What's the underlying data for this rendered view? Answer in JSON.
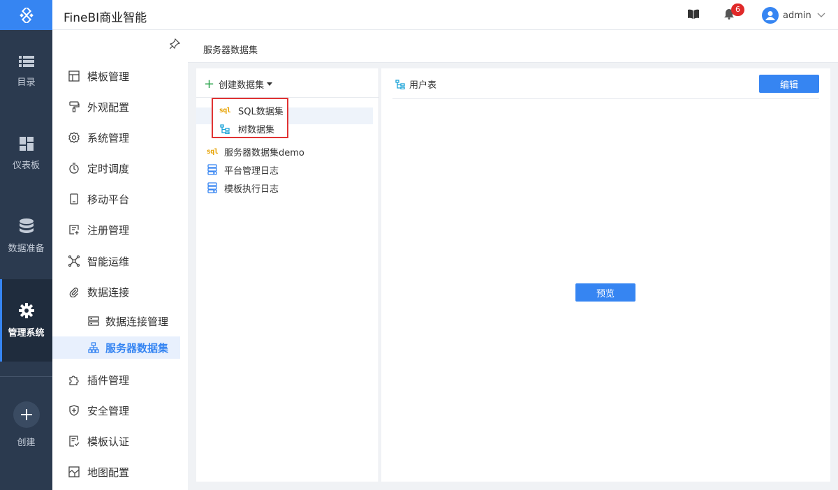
{
  "header": {
    "app_title": "FineBI商业智能",
    "notification_count": "6",
    "user_name": "admin"
  },
  "rail": {
    "items": [
      {
        "label": "目录",
        "icon": "list-icon"
      },
      {
        "label": "仪表板",
        "icon": "dashboard-icon"
      },
      {
        "label": "数据准备",
        "icon": "database-icon"
      },
      {
        "label": "管理系统",
        "icon": "gear-icon",
        "active": true
      }
    ],
    "create_label": "创建"
  },
  "sidebar": {
    "items": [
      {
        "label": "模板管理",
        "icon": "template-icon"
      },
      {
        "label": "外观配置",
        "icon": "brush-icon"
      },
      {
        "label": "系统管理",
        "icon": "settings-icon"
      },
      {
        "label": "定时调度",
        "icon": "timer-icon"
      },
      {
        "label": "移动平台",
        "icon": "mobile-icon"
      },
      {
        "label": "注册管理",
        "icon": "register-icon"
      },
      {
        "label": "智能运维",
        "icon": "network-icon"
      },
      {
        "label": "数据连接",
        "icon": "paperclip-icon"
      },
      {
        "label": "数据连接管理",
        "icon": "server-icon",
        "sub": true
      },
      {
        "label": "服务器数据集",
        "icon": "hierarchy-icon",
        "sub": true,
        "selected": true
      },
      {
        "label": "插件管理",
        "icon": "puzzle-icon"
      },
      {
        "label": "安全管理",
        "icon": "shield-icon"
      },
      {
        "label": "模板认证",
        "icon": "certificate-icon"
      },
      {
        "label": "地图配置",
        "icon": "map-icon"
      }
    ]
  },
  "content": {
    "breadcrumb": "服务器数据集",
    "create_label": "创建数据集",
    "dropdown": [
      {
        "label": "SQL数据集",
        "icon": "sql-icon"
      },
      {
        "label": "树数据集",
        "icon": "tree-icon"
      }
    ],
    "sql_icon_text": "sql",
    "datasets": [
      {
        "label": "服务器数据集demo",
        "icon": "sql-icon"
      },
      {
        "label": "平台管理日志",
        "icon": "db-table-icon"
      },
      {
        "label": "模板执行日志",
        "icon": "db-table-icon"
      }
    ],
    "detail": {
      "title": "用户表",
      "edit_label": "编辑",
      "preview_label": "预览"
    }
  },
  "colors": {
    "accent": "#3685f2",
    "rail_bg": "#2b3a4f",
    "highlight_border": "#e03333",
    "badge": "#e02929"
  }
}
